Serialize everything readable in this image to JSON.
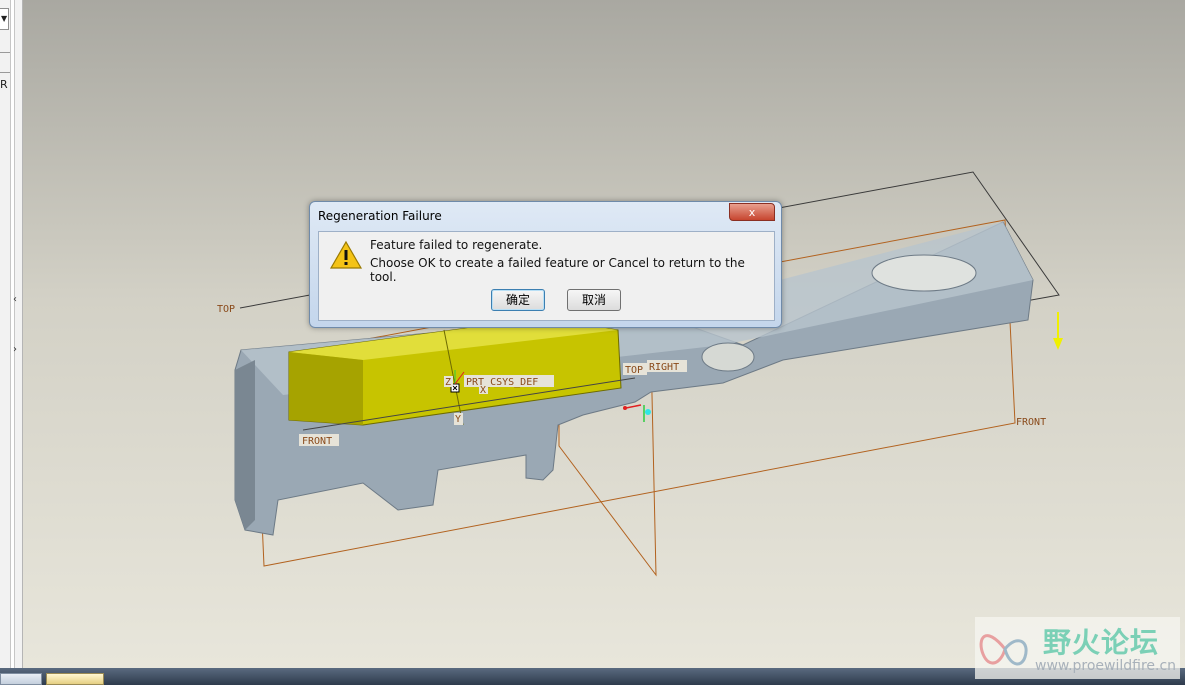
{
  "dialog": {
    "title": "Regeneration Failure",
    "close_glyph": "x",
    "message_line1": "Feature failed to regenerate.",
    "message_line2": "Choose OK to create a failed feature or Cancel to return to the tool.",
    "ok_label": "确定",
    "cancel_label": "取消"
  },
  "viewport": {
    "labels": {
      "top_left": "TOP",
      "top_mid": "TOP",
      "right": "RIGHT",
      "front_left": "FRONT",
      "front_right": "FRONT",
      "csys": "PRT_CSYS_DEF",
      "z_axis": "Z",
      "y_axis": "Y",
      "x_axis": "X"
    }
  },
  "left_panel": {
    "letter": "R",
    "combo_arrow": "▼",
    "arrow_left": "‹",
    "arrow_right": "›"
  },
  "watermark": {
    "title": "野火论坛",
    "url": "www.proewildfire.cn"
  },
  "colors": {
    "part_gray": "#9aa8b4",
    "feature_yellow": "#c7c400",
    "datum_brown": "#b2621f",
    "background": "#d9d7cc"
  }
}
